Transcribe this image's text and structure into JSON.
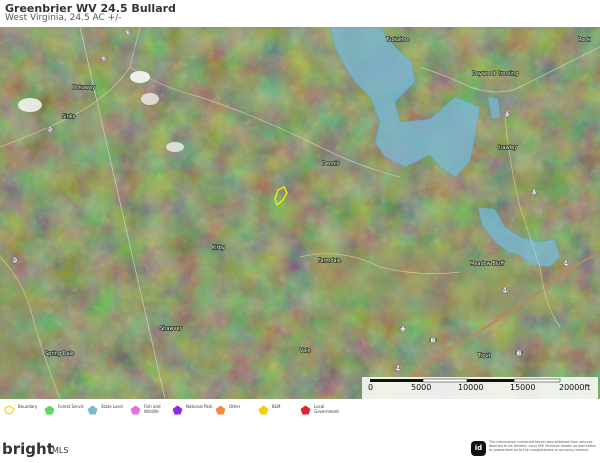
{
  "header": {
    "title": "Greenbrier WV 24.5 Bullard",
    "subtitle": "West Virginia, 24.5 AC +/-"
  },
  "map": {
    "place_labels": [
      "Tuckahoe",
      "Dennis",
      "Pickaway",
      "Sinks",
      "Kirby",
      "Farmdale",
      "Crawley",
      "Meadow Bluff",
      "Shawver",
      "Spring Dale",
      "Vale",
      "Trout",
      "Rock",
      "Daywood Crossing"
    ],
    "route_shields": [
      "28",
      "28",
      "60",
      "63",
      "60",
      "63",
      "64",
      "12",
      "219",
      "64",
      "219",
      "64"
    ],
    "colors": {
      "state_land": "#7ab8d6",
      "boundary": "#f0f000",
      "terrain_base": "#4b5a32"
    }
  },
  "scalebar": {
    "ticks": [
      "0",
      "5000",
      "10000",
      "15000",
      "20000ft"
    ]
  },
  "legend": [
    {
      "label": "Boundary",
      "color": "#f5f200",
      "icon": "boundary-outline"
    },
    {
      "label": "Forest Servic",
      "color": "#5fd85f",
      "icon": "pentagon"
    },
    {
      "label": "State Land",
      "color": "#7ab8d6",
      "icon": "pentagon"
    },
    {
      "label": "Fish and Wildlife",
      "color": "#e66fe0",
      "icon": "pentagon"
    },
    {
      "label": "National Park",
      "color": "#8a2be2",
      "icon": "pentagon"
    },
    {
      "label": "Other",
      "color": "#f58a3d",
      "icon": "pentagon"
    },
    {
      "label": "BLM",
      "color": "#f5d000",
      "icon": "pentagon"
    },
    {
      "label": "Local Government",
      "color": "#e0262c",
      "icon": "pentagon"
    }
  ],
  "footer": {
    "logo_word": "bright",
    "logo_suffix": "MLS",
    "id_badge": "id",
    "disclaimer": "The information contained herein was obtained from sources deemed to be reliable. Land id® Services makes no warranties or guarantees as to the completeness or accuracy thereof."
  }
}
